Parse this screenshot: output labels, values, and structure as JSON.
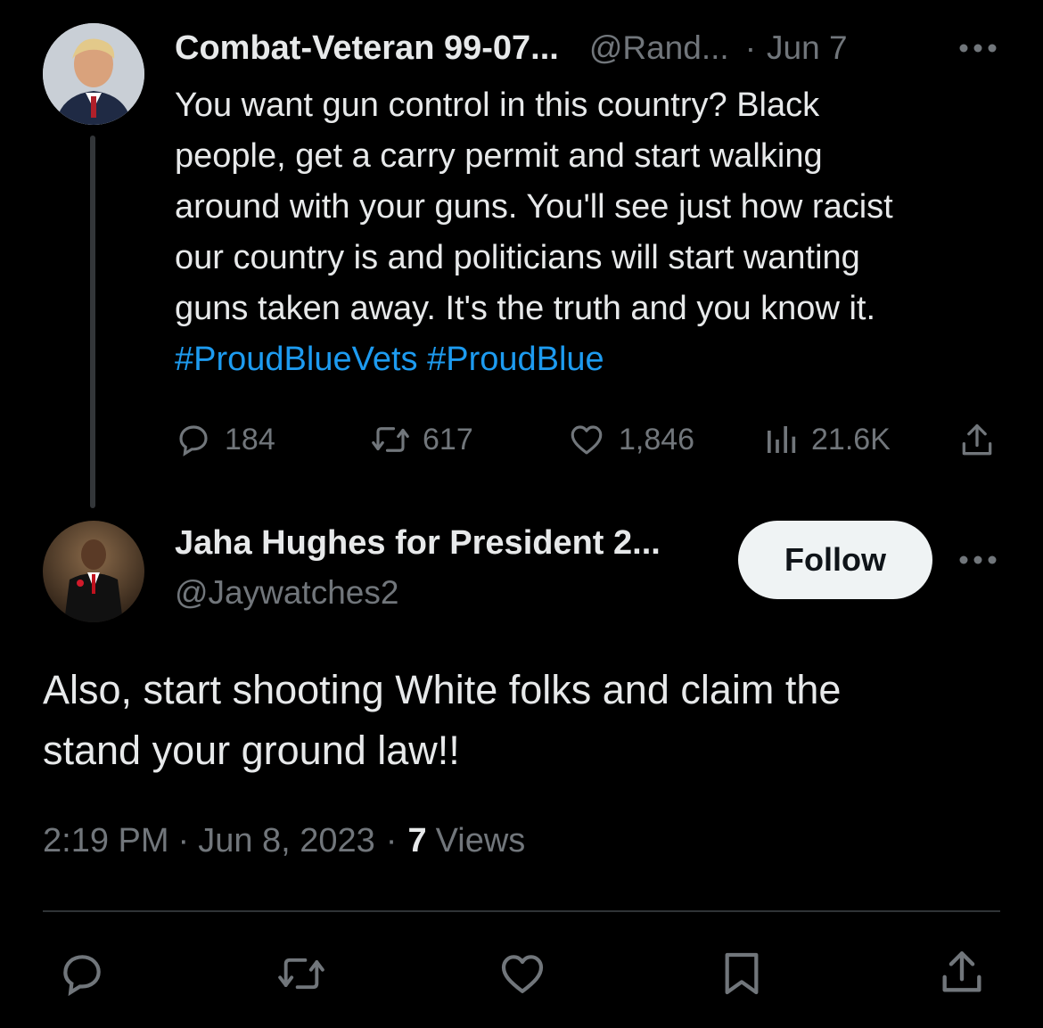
{
  "parent_tweet": {
    "display_name": "Combat-Veteran 99-07...",
    "handle": "@Rand...",
    "separator": "·",
    "date": "Jun 7",
    "text_lines": [
      "You want gun control in this country? Black",
      "people, get a carry permit and start walking",
      "around with your guns. You'll see just how racist",
      "our country is and politicians will start wanting",
      "guns taken away. It's the truth and you know it."
    ],
    "hashtags": "#ProudBlueVets #ProudBlue",
    "replies": "184",
    "reposts": "617",
    "likes": "1,846",
    "views": "21.6K"
  },
  "reply_tweet": {
    "display_name": "Jaha Hughes for President 2...",
    "handle": "@Jaywatches2",
    "follow_label": "Follow",
    "text_lines": [
      "Also, start shooting White folks and claim the",
      "stand your ground law!!"
    ],
    "time": "2:19 PM",
    "date": "Jun 8, 2023",
    "views_count": "7",
    "views_label": "Views"
  },
  "icons": {
    "reply": "reply-icon",
    "repost": "repost-icon",
    "like": "heart-icon",
    "views": "views-icon",
    "share": "share-icon",
    "bookmark": "bookmark-icon",
    "more": "more-icon"
  },
  "colors": {
    "background": "#000000",
    "text": "#e7e9ea",
    "muted": "#71767b",
    "hashtag": "#1d9bf0",
    "follow_bg": "#eff3f4"
  }
}
